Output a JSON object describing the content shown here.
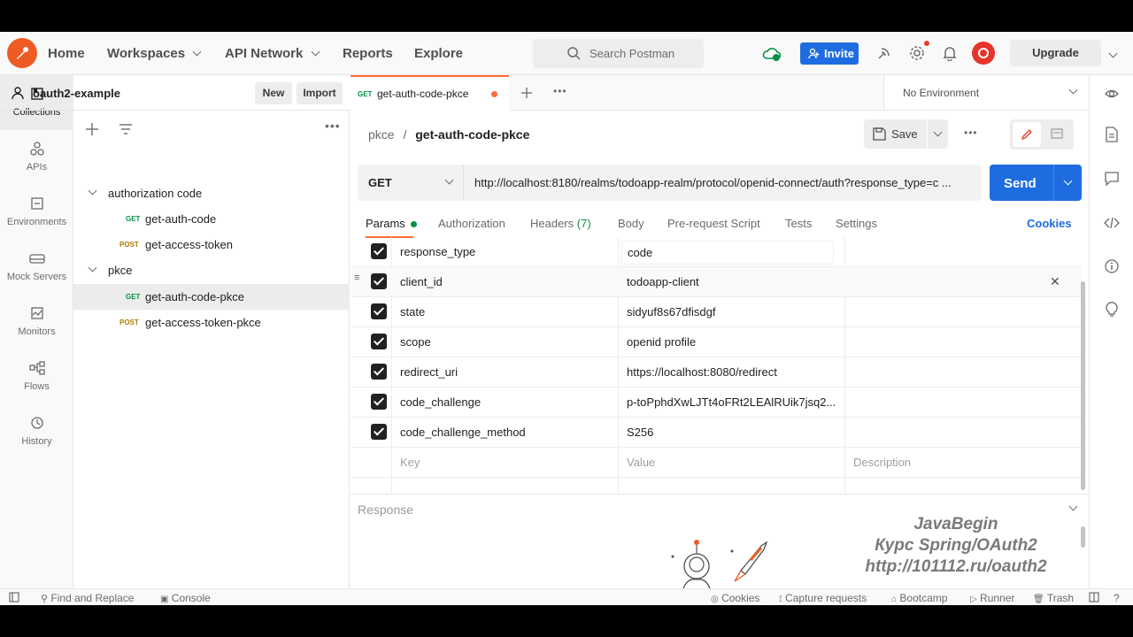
{
  "header": {
    "nav": {
      "home": "Home",
      "workspaces": "Workspaces",
      "api_network": "API Network",
      "reports": "Reports",
      "explore": "Explore"
    },
    "search_placeholder": "Search Postman",
    "invite_label": "Invite",
    "upgrade_label": "Upgrade"
  },
  "rail": [
    {
      "label": "Collections",
      "icon": "collections-icon"
    },
    {
      "label": "APIs",
      "icon": "apis-icon"
    },
    {
      "label": "Environments",
      "icon": "environments-icon"
    },
    {
      "label": "Mock Servers",
      "icon": "mock-servers-icon"
    },
    {
      "label": "Monitors",
      "icon": "monitors-icon"
    },
    {
      "label": "Flows",
      "icon": "flows-icon"
    },
    {
      "label": "History",
      "icon": "history-icon"
    }
  ],
  "workspace": {
    "name": "oauth2-example",
    "new_label": "New",
    "import_label": "Import"
  },
  "tree": {
    "folder1": "authorization code",
    "folder1_items": [
      {
        "method": "GET",
        "name": "get-auth-code"
      },
      {
        "method": "POST",
        "name": "get-access-token"
      }
    ],
    "folder2": "pkce",
    "folder2_items": [
      {
        "method": "GET",
        "name": "get-auth-code-pkce"
      },
      {
        "method": "POST",
        "name": "get-access-token-pkce"
      }
    ]
  },
  "tab": {
    "method": "GET",
    "name": "get-auth-code-pkce"
  },
  "environment": "No Environment",
  "breadcrumb": {
    "collection": "pkce",
    "separator": "/",
    "request": "get-auth-code-pkce"
  },
  "save_label": "Save",
  "request": {
    "method": "GET",
    "url": "http://localhost:8180/realms/todoapp-realm/protocol/openid-connect/auth?response_type=c ...",
    "send_label": "Send"
  },
  "subtabs": {
    "params": "Params",
    "authorization": "Authorization",
    "headers": "Headers",
    "headers_count": "(7)",
    "body": "Body",
    "pre_request": "Pre-request Script",
    "tests": "Tests",
    "settings": "Settings",
    "cookies": "Cookies"
  },
  "params": [
    {
      "key": "response_type",
      "value": "code"
    },
    {
      "key": "client_id",
      "value": "todoapp-client"
    },
    {
      "key": "state",
      "value": "sidyuf8s67dfisdgf"
    },
    {
      "key": "scope",
      "value": "openid profile"
    },
    {
      "key": "redirect_uri",
      "value": "https://localhost:8080/redirect"
    },
    {
      "key": "code_challenge",
      "value": "p-toPphdXwLJTt4oFRt2LEAlRUik7jsq2..."
    },
    {
      "key": "code_challenge_method",
      "value": "S256"
    }
  ],
  "param_placeholders": {
    "key": "Key",
    "value": "Value",
    "description": "Description"
  },
  "response_label": "Response",
  "watermark": {
    "line1": "JavaBegin",
    "line2": "Курс Spring/OAuth2",
    "line3": "http://101112.ru/oauth2"
  },
  "statusbar": {
    "find_replace": "Find and Replace",
    "console": "Console",
    "cookies": "Cookies",
    "capture": "Capture requests",
    "bootcamp": "Bootcamp",
    "runner": "Runner",
    "trash": "Trash"
  },
  "colors": {
    "accent": "#ff6c37",
    "primary": "#1e6ce0",
    "get": "#0b8f49",
    "post": "#ad7a03"
  }
}
